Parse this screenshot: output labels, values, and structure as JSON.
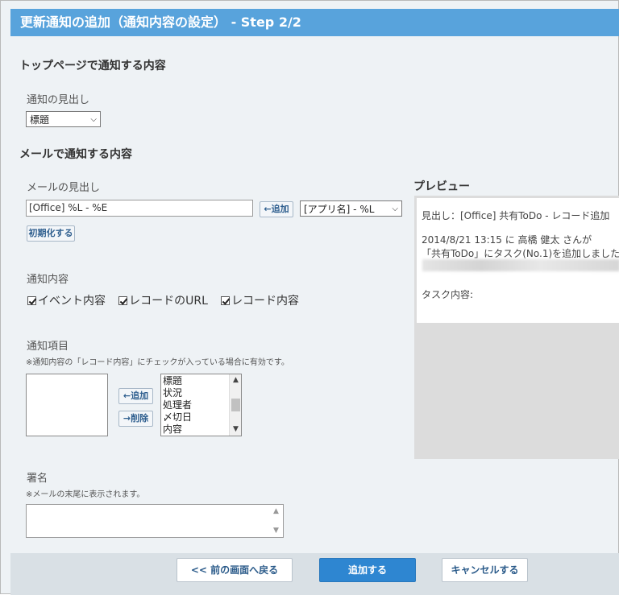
{
  "title": "更新通知の追加（通知内容の設定） - Step 2/2",
  "top_section": {
    "heading": "トップページで通知する内容",
    "heading_field_label": "通知の見出し",
    "heading_select_value": "標題"
  },
  "mail_section": {
    "heading": "メールで通知する内容",
    "subject_label": "メールの見出し",
    "subject_value": "[Office] %L - %E",
    "add_button": "←追加",
    "insert_select_value": "[アプリ名] - %L",
    "reset_button": "初期化する",
    "content_label": "通知内容",
    "checkboxes": [
      {
        "label": "イベント内容",
        "checked": true
      },
      {
        "label": "レコードのURL",
        "checked": true
      },
      {
        "label": "レコード内容",
        "checked": true
      }
    ],
    "items_label": "通知項目",
    "items_note": "※通知内容の「レコード内容」にチェックが入っている場合に有効です。",
    "items_add_button": "←追加",
    "items_remove_button": "→削除",
    "available_items": [
      "標題",
      "状況",
      "処理者",
      "〆切日",
      "内容"
    ],
    "signature_label": "署名",
    "signature_note": "※メールの末尾に表示されます。"
  },
  "preview": {
    "heading": "プレビュー",
    "subject_line": "見出し：[Office] 共有ToDo - レコード追加",
    "body_line1": "2014/8/21 13:15 に 高橋 健太 さんが",
    "body_line2": "「共有ToDo」にタスク(No.1)を追加しました",
    "content_label": "タスク内容:"
  },
  "footer": {
    "back_button": "<< 前の画面へ戻る",
    "add_button": "追加する",
    "cancel_button": "キャンセルする"
  },
  "colors": {
    "titlebar": "#58a3dc",
    "primary_button": "#2e86d1",
    "page_background": "#eef2f5"
  }
}
